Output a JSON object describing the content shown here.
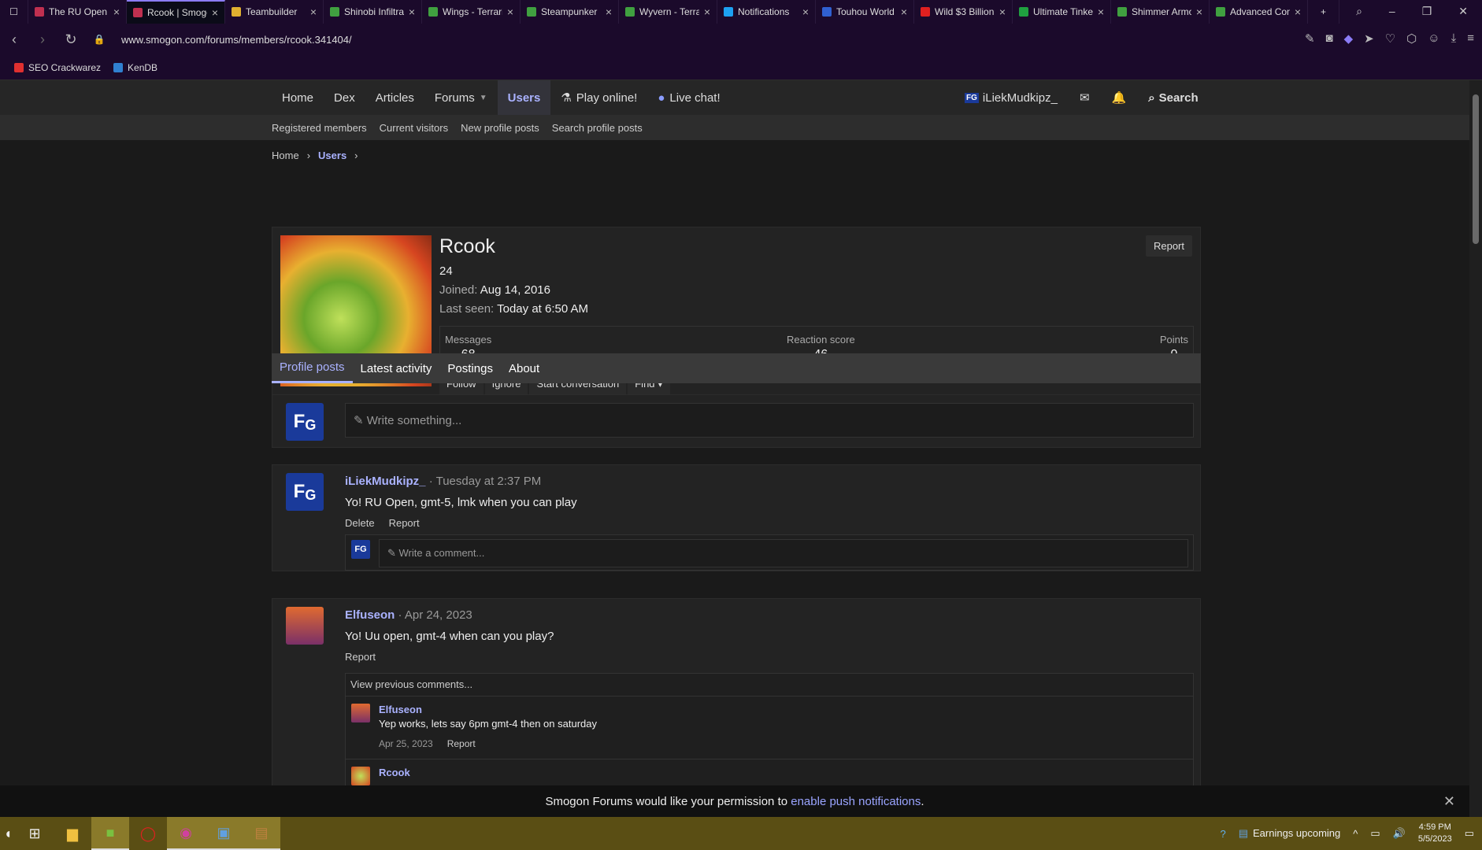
{
  "browser": {
    "tabs": [
      {
        "label": "The RU Open",
        "color": "#c03050"
      },
      {
        "label": "Rcook | Smogon",
        "color": "#c03050",
        "active": true
      },
      {
        "label": "Teambuilder",
        "color": "#e0b030"
      },
      {
        "label": "Shinobi Infiltrator",
        "color": "#40a040"
      },
      {
        "label": "Wings - Terraria",
        "color": "#40a040"
      },
      {
        "label": "Steampunker",
        "color": "#40a040"
      },
      {
        "label": "Wyvern - Terraria",
        "color": "#40a040"
      },
      {
        "label": "Notifications",
        "color": "#1da1f2"
      },
      {
        "label": "Touhou World",
        "color": "#3060d0"
      },
      {
        "label": "Wild $3 Billion",
        "color": "#e02020"
      },
      {
        "label": "Ultimate Tinkerer",
        "color": "#20a040"
      },
      {
        "label": "Shimmer Armor",
        "color": "#40a040"
      },
      {
        "label": "Advanced Combat",
        "color": "#40a040"
      }
    ],
    "url": "www.smogon.com/forums/members/rcook.341404/",
    "bookmarks": [
      {
        "label": "SEO Crackwarez",
        "color": "#e03030"
      },
      {
        "label": "KenDB",
        "color": "#3080d0"
      }
    ]
  },
  "site": {
    "nav": [
      "Home",
      "Dex",
      "Articles",
      "Forums",
      "Users"
    ],
    "play": "Play online!",
    "chat": "Live chat!",
    "user": "iLiekMudkipz_",
    "search": "Search",
    "subnav": [
      "Registered members",
      "Current visitors",
      "New profile posts",
      "Search profile posts"
    ],
    "breadcrumb": {
      "home": "Home",
      "users": "Users"
    }
  },
  "profile": {
    "name": "Rcook",
    "age": "24",
    "joined_label": "Joined:",
    "joined": "Aug 14, 2016",
    "lastseen_label": "Last seen:",
    "lastseen": "Today at 6:50 AM",
    "report": "Report",
    "stats": {
      "messages_label": "Messages",
      "messages": "68",
      "reaction_label": "Reaction score",
      "reaction": "46",
      "points_label": "Points",
      "points": "0"
    },
    "actions": {
      "follow": "Follow",
      "ignore": "Ignore",
      "conversation": "Start conversation",
      "find": "Find ▾"
    }
  },
  "tabs": [
    "Profile posts",
    "Latest activity",
    "Postings",
    "About"
  ],
  "write_placeholder": "✎ Write something...",
  "posts": [
    {
      "user": "iLiekMudkipz_",
      "time": "· Tuesday at 2:37 PM",
      "text": "Yo! RU Open, gmt-5, lmk when you can play",
      "delete": "Delete",
      "report": "Report",
      "comment_placeholder": "✎ Write a comment..."
    },
    {
      "user": "Elfuseon",
      "time": "· Apr 24, 2023",
      "text": "Yo! Uu open, gmt-4 when can you play?",
      "report": "Report",
      "view_prev": "View previous comments...",
      "comments": [
        {
          "user": "Elfuseon",
          "text": "Yep works, lets say 6pm gmt-4 then on saturday",
          "date": "Apr 25, 2023",
          "report": "Report"
        },
        {
          "user": "Rcook"
        }
      ]
    }
  ],
  "notification": {
    "text": "Smogon Forums would like your permission to ",
    "link": "enable push notifications",
    "end": "."
  },
  "taskbar": {
    "news": "Earnings upcoming",
    "time": "4:59 PM",
    "date": "5/5/2023"
  }
}
